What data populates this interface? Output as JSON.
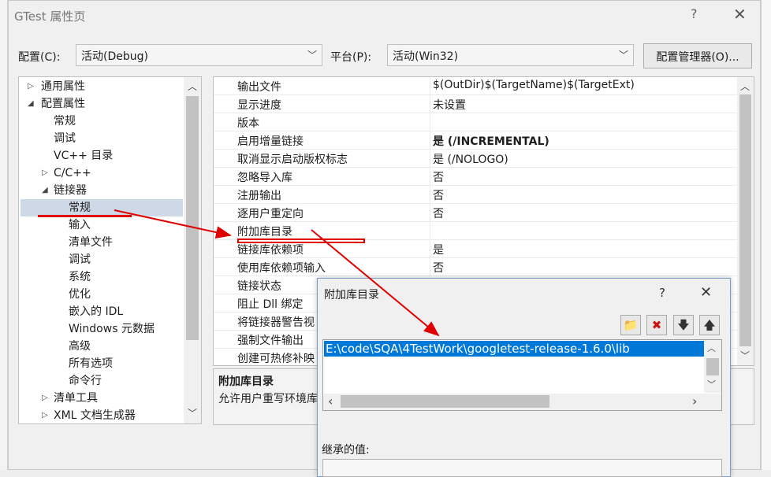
{
  "main_window": {
    "title": "GTest 属性页",
    "help": "?",
    "close": "✕"
  },
  "config_bar": {
    "config_label": "配置(C):",
    "config_value": "活动(Debug)",
    "platform_label": "平台(P):",
    "platform_value": "活动(Win32)",
    "manager_button": "配置管理器(O)..."
  },
  "tree": {
    "items": [
      {
        "label": "通用属性",
        "arrow": "▷"
      },
      {
        "label": "配置属性",
        "arrow": "◢"
      },
      {
        "label": "常规",
        "arrow": ""
      },
      {
        "label": "调试",
        "arrow": ""
      },
      {
        "label": "VC++ 目录",
        "arrow": ""
      },
      {
        "label": "C/C++",
        "arrow": "▷"
      },
      {
        "label": "链接器",
        "arrow": "◢"
      },
      {
        "label": "常规",
        "arrow": ""
      },
      {
        "label": "输入",
        "arrow": ""
      },
      {
        "label": "清单文件",
        "arrow": ""
      },
      {
        "label": "调试",
        "arrow": ""
      },
      {
        "label": "系统",
        "arrow": ""
      },
      {
        "label": "优化",
        "arrow": ""
      },
      {
        "label": "嵌入的 IDL",
        "arrow": ""
      },
      {
        "label": "Windows 元数据",
        "arrow": ""
      },
      {
        "label": "高级",
        "arrow": ""
      },
      {
        "label": "所有选项",
        "arrow": ""
      },
      {
        "label": "命令行",
        "arrow": ""
      },
      {
        "label": "清单工具",
        "arrow": "▷"
      },
      {
        "label": "XML 文档生成器",
        "arrow": "▷"
      }
    ]
  },
  "grid": {
    "rows": [
      {
        "name": "输出文件",
        "value": "$(OutDir)$(TargetName)$(TargetExt)"
      },
      {
        "name": "显示进度",
        "value": "未设置"
      },
      {
        "name": "版本",
        "value": ""
      },
      {
        "name": "启用增量链接",
        "value": "是 (/INCREMENTAL)"
      },
      {
        "name": "取消显示启动版权标志",
        "value": "是 (/NOLOGO)"
      },
      {
        "name": "忽略导入库",
        "value": "否"
      },
      {
        "name": "注册输出",
        "value": "否"
      },
      {
        "name": "逐用户重定向",
        "value": "否"
      },
      {
        "name": "附加库目录",
        "value": ""
      },
      {
        "name": "链接库依赖项",
        "value": "是"
      },
      {
        "name": "使用库依赖项输入",
        "value": "否"
      },
      {
        "name": "链接状态",
        "value": ""
      },
      {
        "name": "阻止 Dll 绑定",
        "value": ""
      },
      {
        "name": "将链接器警告视",
        "value": ""
      },
      {
        "name": "强制文件输出",
        "value": ""
      },
      {
        "name": "创建可热修补映",
        "value": ""
      }
    ]
  },
  "description": {
    "title": "附加库目录",
    "text": "允许用户重写环境库"
  },
  "popup": {
    "title": "附加库目录",
    "help": "?",
    "close": "✕",
    "list_item": "E:\\code\\SQA\\4TestWork\\googletest-release-1.6.0\\lib",
    "inherit_label": "继承的值:"
  },
  "icons": {
    "folder": "📁",
    "delete": "✖",
    "down": "🡇",
    "up": "🡅",
    "scroll_up": "⌃",
    "scroll_down": "⌄",
    "scroll_left": "‹",
    "scroll_right": "›"
  },
  "colors": {
    "selection": "#0078d7",
    "tree_selection": "#cce0f0",
    "annotation": "#e00000"
  }
}
